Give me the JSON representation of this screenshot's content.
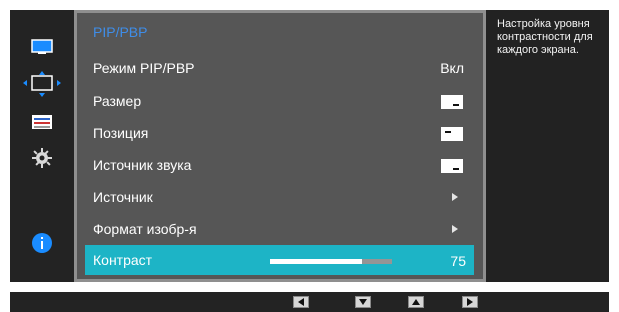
{
  "menu": {
    "title": "PIP/PBP",
    "rows": [
      {
        "label": "Режим PIP/PBP",
        "value": "Вкл"
      },
      {
        "label": "Размер",
        "icon": "size-icon"
      },
      {
        "label": "Позиция",
        "icon": "position-icon"
      },
      {
        "label": "Источник звука",
        "icon": "audio-source-icon"
      },
      {
        "label": "Источник",
        "icon": "chevron-right-icon"
      },
      {
        "label": "Формат изобр-я",
        "icon": "chevron-right-icon"
      },
      {
        "label": "Контраст",
        "value": "75",
        "level": 0.75
      }
    ]
  },
  "help": {
    "text": "Настройка уровня контрастности для каждого экрана."
  },
  "sidebar": {
    "icons": [
      "picture-icon",
      "pip-icon",
      "settings-bars-icon",
      "gear-icon",
      "info-icon"
    ]
  },
  "controls": {
    "buttons": [
      "left-arrow-icon",
      "down-arrow-icon",
      "up-arrow-icon",
      "right-arrow-icon"
    ]
  },
  "colors": {
    "accent": "#1db4c6",
    "title": "#3f8de8",
    "icon_blue": "#1a8cff"
  }
}
